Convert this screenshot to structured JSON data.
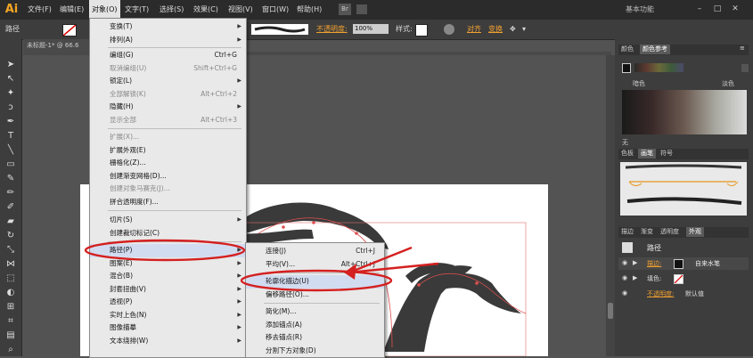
{
  "menubar": {
    "logo": "Ai",
    "items": [
      "文件(F)",
      "编辑(E)",
      "对象(O)",
      "文字(T)",
      "选择(S)",
      "效果(C)",
      "视图(V)",
      "窗口(W)",
      "帮助(H)"
    ],
    "bridge": "Br",
    "workspace": "基本功能",
    "window_buttons": [
      "–",
      "□",
      "✕"
    ]
  },
  "controlbar": {
    "left_label": "路径",
    "opacity_label": "不透明度:",
    "opacity_value": "100%",
    "style_label": "样式:",
    "align_label": "对齐",
    "transform_label": "变换"
  },
  "document": {
    "tab_title": "未标题-1* @ 66.6"
  },
  "object_menu": {
    "items": [
      {
        "label": "变换(T)",
        "sub": true
      },
      {
        "label": "排列(A)",
        "sub": true
      },
      {
        "sep": true
      },
      {
        "label": "编组(G)",
        "shortcut": "Ctrl+G"
      },
      {
        "label": "取消编组(U)",
        "shortcut": "Shift+Ctrl+G",
        "disabled": true
      },
      {
        "label": "锁定(L)",
        "sub": true
      },
      {
        "label": "全部解锁(K)",
        "shortcut": "Alt+Ctrl+2",
        "disabled": true
      },
      {
        "label": "隐藏(H)",
        "sub": true
      },
      {
        "label": "显示全部",
        "shortcut": "Alt+Ctrl+3",
        "disabled": true
      },
      {
        "sep": true
      },
      {
        "label": "扩展(X)...",
        "disabled": true
      },
      {
        "label": "扩展外观(E)"
      },
      {
        "label": "栅格化(Z)..."
      },
      {
        "label": "创建渐变网格(D)..."
      },
      {
        "label": "创建对象马赛克(J)...",
        "disabled": true
      },
      {
        "label": "拼合透明度(F)..."
      },
      {
        "sep": true
      },
      {
        "label": "切片(S)",
        "sub": true
      },
      {
        "label": "创建裁切标记(C)"
      },
      {
        "sep": true
      },
      {
        "label": "路径(P)",
        "sub": true,
        "highlight": true
      },
      {
        "label": "图案(E)",
        "sub": true
      },
      {
        "label": "混合(B)",
        "sub": true
      },
      {
        "label": "封套扭曲(V)",
        "sub": true
      },
      {
        "label": "透视(P)",
        "sub": true
      },
      {
        "label": "实时上色(N)",
        "sub": true
      },
      {
        "label": "图像描摹",
        "sub": true
      },
      {
        "label": "文本绕排(W)",
        "sub": true
      }
    ]
  },
  "path_submenu": {
    "items": [
      {
        "label": "连接(J)",
        "shortcut": "Ctrl+J"
      },
      {
        "label": "平均(V)...",
        "shortcut": "Alt+Ctrl+J"
      },
      {
        "sep": true
      },
      {
        "label": "轮廓化描边(U)",
        "highlight": true
      },
      {
        "label": "偏移路径(O)..."
      },
      {
        "sep": true
      },
      {
        "label": "简化(M)..."
      },
      {
        "label": "添加锚点(A)"
      },
      {
        "label": "移去锚点(R)"
      },
      {
        "label": "分割下方对象(D)"
      }
    ]
  },
  "panels": {
    "color_tabs": [
      "颜色",
      "颜色参考"
    ],
    "dark_label": "暗色",
    "light_label": "淡色",
    "none_label": "无",
    "brush_tabs": [
      "色板",
      "画笔",
      "符号"
    ],
    "appearance_tabs": [
      "描边",
      "渐变",
      "透明度",
      "外观"
    ],
    "appearance_title": "路径",
    "stroke_label": "描边:",
    "stroke_value": "自来水笔",
    "fill_label": "填色:",
    "opacity_label": "不透明度:",
    "opacity_value": "默认值",
    "fx_label": "fx."
  },
  "colors": {
    "accent_orange": "#e8a33c",
    "annotation_red": "#d42020",
    "menu_bg": "#e9e9e9",
    "ui_dark": "#3d3d3d"
  }
}
